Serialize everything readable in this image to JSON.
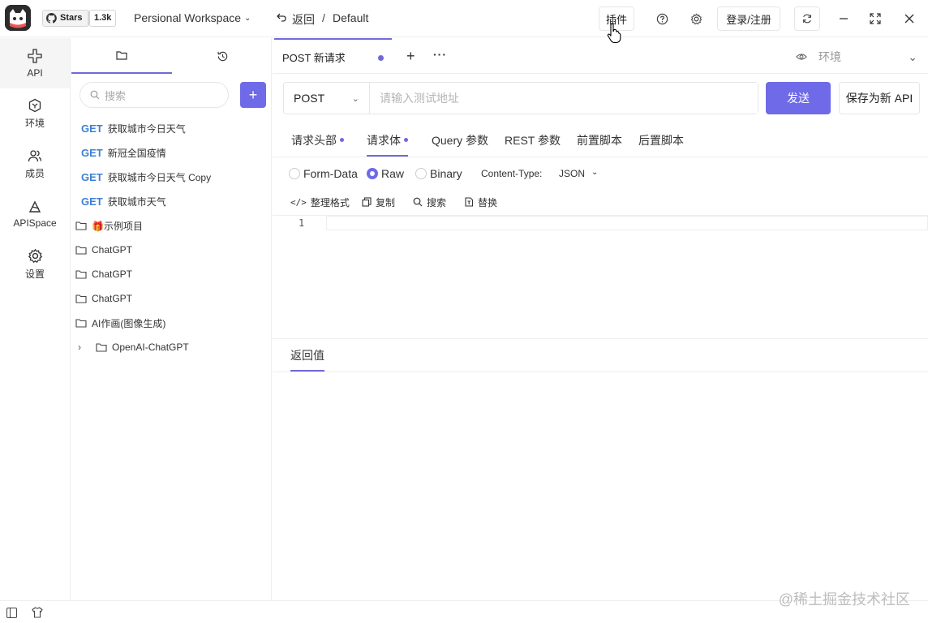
{
  "header": {
    "github_label": "Stars",
    "github_count": "1.3k",
    "workspace": "Persional Workspace",
    "back_label": "返回",
    "breadcrumb_sep": "/",
    "breadcrumb": "Default",
    "plugin_label": "插件",
    "login_label": "登录/注册"
  },
  "rail": {
    "items": [
      {
        "label": "API",
        "icon": "api-icon"
      },
      {
        "label": "环境",
        "icon": "environment-icon"
      },
      {
        "label": "成员",
        "icon": "members-icon"
      },
      {
        "label": "APISpace",
        "icon": "apispace-icon"
      },
      {
        "label": "设置",
        "icon": "settings-icon"
      }
    ]
  },
  "explorer": {
    "search_placeholder": "搜索",
    "items": [
      {
        "method": "GET",
        "label": "获取城市今日天气"
      },
      {
        "method": "GET",
        "label": "新冠全国疫情"
      },
      {
        "method": "GET",
        "label": "获取城市今日天气 Copy"
      },
      {
        "method": "GET",
        "label": "获取城市天气"
      }
    ],
    "folders": [
      {
        "label": "🎁示例项目"
      },
      {
        "label": "ChatGPT"
      },
      {
        "label": "ChatGPT"
      },
      {
        "label": "ChatGPT"
      },
      {
        "label": "AI作画(图像生成)"
      }
    ],
    "subfolder": {
      "label": "OpenAI-ChatGPT"
    }
  },
  "main": {
    "tab_title": "POST 新请求",
    "env_label": "环境",
    "method": "POST",
    "url_placeholder": "请输入测试地址",
    "send_label": "发送",
    "save_label": "保存为新 API",
    "sub_tabs": [
      {
        "label": "请求头部"
      },
      {
        "label": "请求体"
      },
      {
        "label": "Query 参数"
      },
      {
        "label": "REST 参数"
      },
      {
        "label": "前置脚本"
      },
      {
        "label": "后置脚本"
      }
    ],
    "body_types": [
      {
        "label": "Form-Data"
      },
      {
        "label": "Raw"
      },
      {
        "label": "Binary"
      }
    ],
    "content_type_label": "Content-Type:",
    "content_type_value": "JSON",
    "tools": [
      {
        "label": "整理格式"
      },
      {
        "label": "复制"
      },
      {
        "label": "搜索"
      },
      {
        "label": "替换"
      }
    ],
    "line_number": "1",
    "response_tab": "返回值"
  },
  "watermark": "@稀土掘金技术社区",
  "colors": {
    "accent": "#6f6ae8",
    "get_method": "#3f7fd6"
  }
}
